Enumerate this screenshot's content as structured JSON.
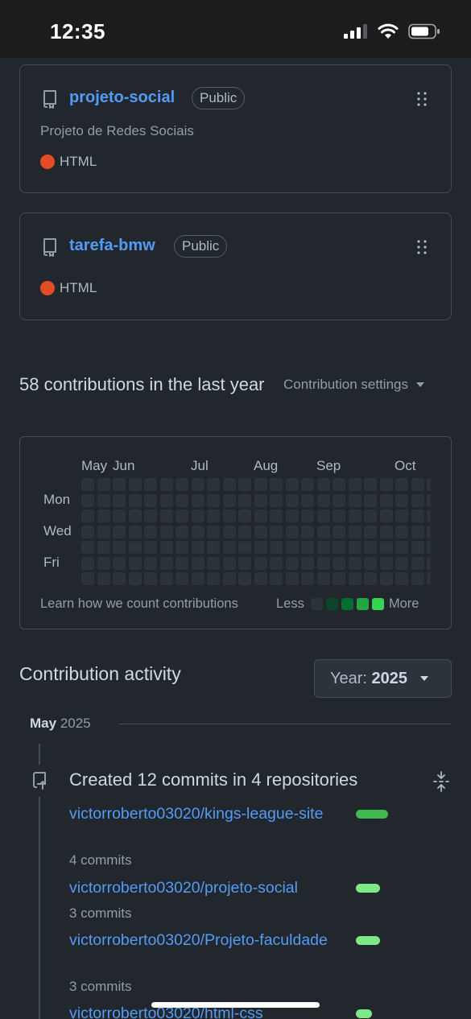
{
  "status_bar": {
    "time": "12:35"
  },
  "repos": [
    {
      "name": "projeto-social",
      "visibility": "Public",
      "description": "Projeto de Redes Sociais",
      "language": "HTML",
      "language_color": "#e34c26"
    },
    {
      "name": "tarefa-bmw",
      "visibility": "Public",
      "description": "",
      "language": "HTML",
      "language_color": "#e34c26"
    }
  ],
  "contributions": {
    "title": "58 contributions in the last year",
    "settings_label": "Contribution settings",
    "months": [
      "May",
      "Jun",
      "Jul",
      "Aug",
      "Sep",
      "Oct"
    ],
    "days": [
      "Mon",
      "Wed",
      "Fri"
    ],
    "learn_text": "Learn how we count contributions",
    "legend_less": "Less",
    "legend_more": "More",
    "legend_colors": [
      "#2d333b",
      "#0e4429",
      "#006d32",
      "#26a641",
      "#39d353"
    ]
  },
  "activity": {
    "title": "Contribution activity",
    "year_label": "Year:",
    "year_value": "2025",
    "month_name": "May",
    "month_year": "2025",
    "heading": "Created 12 commits in 4 repositories",
    "items": [
      {
        "repo": "victorroberto03020/kings-league-site",
        "commits": "4 commits",
        "bar_color": "#3fb950"
      },
      {
        "repo": "victorroberto03020/projeto-social",
        "commits": "3 commits",
        "bar_color": "#7ee787"
      },
      {
        "repo": "victorroberto03020/Projeto-faculdade",
        "commits": "3 commits",
        "bar_color": "#7ee787"
      },
      {
        "repo": "victorroberto03020/html-css",
        "commits": "",
        "bar_color": "#7ee787"
      }
    ]
  }
}
